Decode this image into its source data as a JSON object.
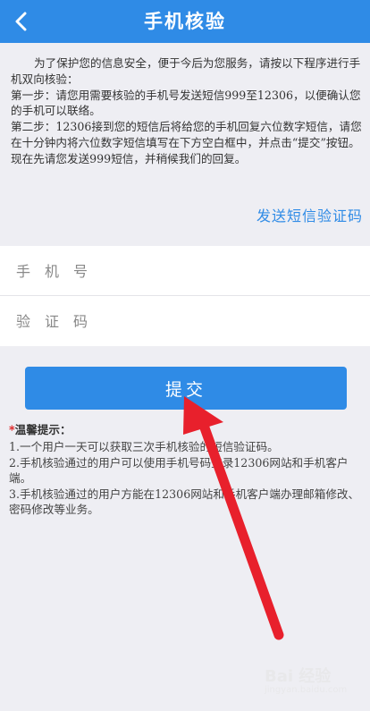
{
  "header": {
    "title": "手机核验",
    "back_icon": "back-chevron-icon"
  },
  "intro": {
    "paragraph": "为了保护您的信息安全，便于今后为您服务，请按以下程序进行手机双向核验：",
    "step1": "第一步：请您用需要核验的手机号发送短信999至12306，以便确认您的手机可以联络。",
    "step2": "第二步：12306接到您的短信后将给您的手机回复六位数字短信，请您在十分钟内将六位数字短信填写在下方空白框中，并点击“提交”按钮。 现在先请您发送999短信，并稍候我们的回复。"
  },
  "send_sms_label": "发送短信验证码",
  "form": {
    "phone_placeholder": "手机号",
    "code_placeholder": "验证码",
    "phone_value": "",
    "code_value": ""
  },
  "submit_label": "提交",
  "tips": {
    "star": "*",
    "title": "温馨提示：",
    "items": [
      "1.一个用户一天可以获取三次手机核验的短信验证码。",
      "2.手机核验通过的用户可以使用手机号码登录12306网站和手机客户端。",
      "3.手机核验通过的用户方能在12306网站和手机客户端办理邮箱修改、密码修改等业务。"
    ]
  },
  "colors": {
    "primary": "#2f8be6",
    "background": "#eeeef3",
    "arrow": "#e8202c"
  },
  "watermark": {
    "text": "Bai 经验",
    "sub": "jingyan.baidu.com"
  }
}
